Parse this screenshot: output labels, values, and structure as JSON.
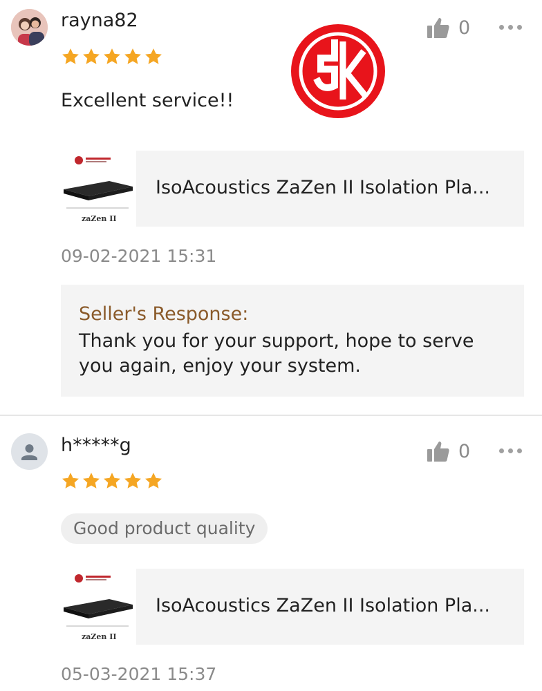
{
  "reviews": [
    {
      "username": "rayna82",
      "rating": 5,
      "like_count": "0",
      "text": "Excellent service!!",
      "product": {
        "title": "IsoAcoustics ZaZen II Isolation Pla...",
        "thumb_caption": "zaZen II"
      },
      "date": "09-02-2021 15:31",
      "seller_response": {
        "label": "Seller's Response:",
        "text": "Thank you for your support, hope to serve you again, enjoy your system."
      }
    },
    {
      "username": "h*****g",
      "rating": 5,
      "like_count": "0",
      "tag": "Good product quality",
      "product": {
        "title": "IsoAcoustics ZaZen II Isolation Pla...",
        "thumb_caption": "zaZen II"
      },
      "date": "05-03-2021 15:37"
    }
  ],
  "colors": {
    "star": "#f5a623",
    "watermark_red": "#e8141b",
    "seller_label": "#8a5a2a"
  },
  "icons": [
    "user-photo-avatar",
    "default-user-icon",
    "star-icon",
    "thumbs-up-icon",
    "more-options-icon",
    "brand-watermark-logo"
  ]
}
